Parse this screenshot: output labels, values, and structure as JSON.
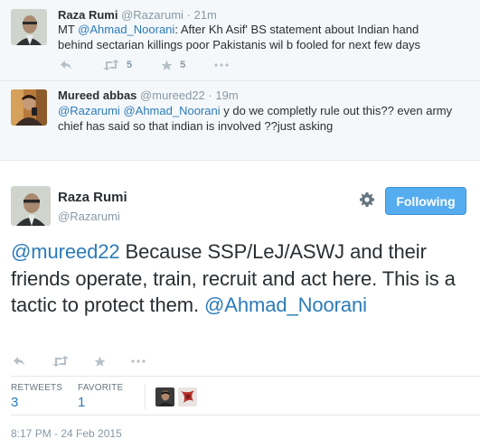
{
  "context_tweets": [
    {
      "name": "Raza Rumi",
      "handle": "@Razarumi",
      "time": "· 21m",
      "text_parts": [
        {
          "t": "MT ",
          "m": false
        },
        {
          "t": "@Ahmad_Noorani",
          "m": true
        },
        {
          "t": ": After Kh Asif' BS statement about Indian hand behind sectarian killings poor Pakistanis wil b fooled for next few days",
          "m": false
        }
      ],
      "retweets": "5",
      "favorites": "5"
    },
    {
      "name": "Mureed abbas",
      "handle": "@mureed22",
      "time": "· 19m",
      "text_parts": [
        {
          "t": "@Razarumi",
          "m": true
        },
        {
          "t": " ",
          "m": false
        },
        {
          "t": "@Ahmad_Noorani",
          "m": true
        },
        {
          "t": " y do we completly rule out this?? even army chief has said so that indian is involved ??just asking",
          "m": false
        }
      ]
    }
  ],
  "main_tweet": {
    "name": "Raza Rumi",
    "handle": "@Razarumi",
    "follow_label": "Following",
    "text_parts": [
      {
        "t": "@mureed22",
        "m": true
      },
      {
        "t": " Because SSP/LeJ/ASWJ and their friends operate, train, recruit and act here. This is a tactic to protect them. ",
        "m": false
      },
      {
        "t": "@Ahmad_Noorani",
        "m": true
      }
    ],
    "stats": {
      "retweets_label": "RETWEETS",
      "retweets_value": "3",
      "favorites_label": "FAVORITE",
      "favorites_value": "1"
    },
    "timestamp": "8:17 PM - 24 Feb 2015"
  },
  "colors": {
    "link": "#2b7bb9",
    "follow_button": "#55acee",
    "muted": "#8899a6"
  },
  "icons": [
    "reply-icon",
    "retweet-icon",
    "favorite-icon",
    "more-icon",
    "gear-icon"
  ]
}
